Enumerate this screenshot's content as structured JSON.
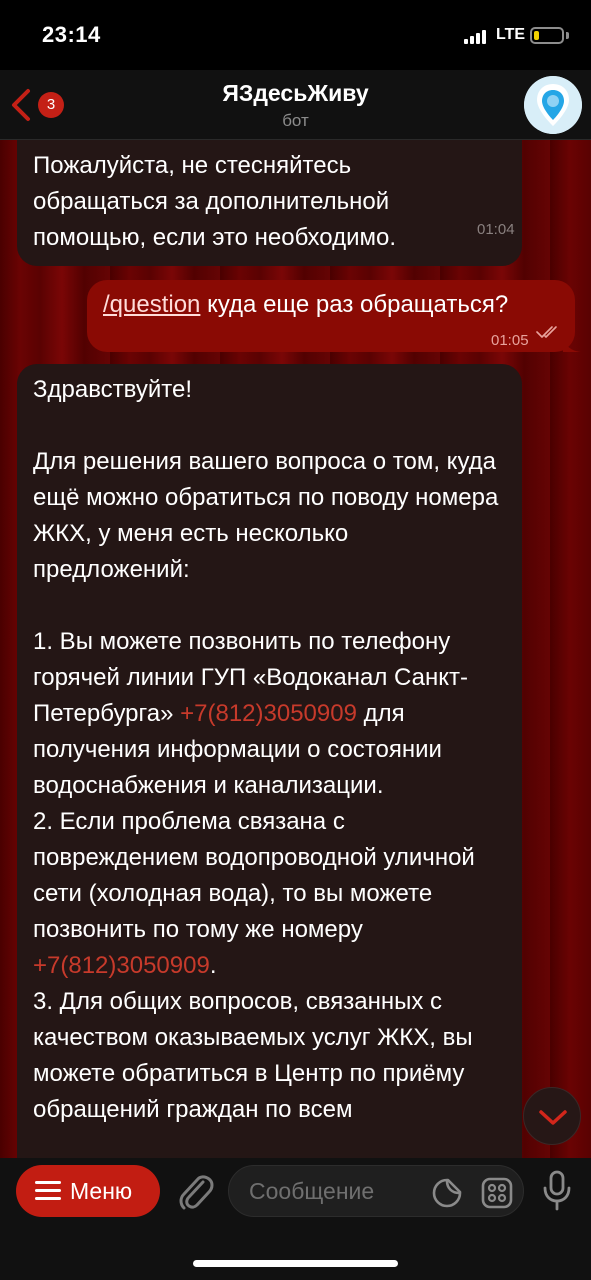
{
  "status_bar": {
    "time": "23:14",
    "network": "LTE",
    "battery_level": 0.2,
    "battery_color": "#f3d200"
  },
  "header": {
    "back_badge": "3",
    "title": "ЯЗдесьЖиву",
    "subtitle": "бот",
    "avatar_icon": "location-pin-icon"
  },
  "messages": [
    {
      "direction": "incoming",
      "text": "Пожалуйста, не стесняйтесь обращаться за дополнительной помощью, если это необходимо.",
      "time": "01:04"
    },
    {
      "direction": "outgoing",
      "command": "/question",
      "text": " куда еще раз обращаться?",
      "time": "01:05",
      "status": "read"
    },
    {
      "direction": "incoming",
      "text_parts": [
        "Здравствуйте!\n\nДля решения вашего вопроса о том, куда ещё можно обратиться по поводу номера ЖКХ, у меня есть несколько предложений:\n\n1. Вы можете позвонить по телефону горячей линии ГУП «Водоканал Санкт-Петербурга» ",
        "+7(812)3050909",
        " для получения информации о состоянии водоснабжения и канализации.\n2. Если проблема связана с повреждением водопроводной уличной сети (холодная вода), то вы можете позвонить по тому же номеру ",
        "+7(812)3050909",
        ".\n3. Для общих вопросов, связанных с качеством оказываемых услуг ЖКХ, вы можете обратиться в Центр по приёму обращений граждан по всем"
      ]
    }
  ],
  "input_bar": {
    "menu_label": "Меню",
    "placeholder": "Сообщение"
  },
  "colors": {
    "accent": "#c21d12",
    "outgoing_bubble": "#8a0a04",
    "incoming_bubble": "#241615",
    "link": "#c73a2b"
  }
}
